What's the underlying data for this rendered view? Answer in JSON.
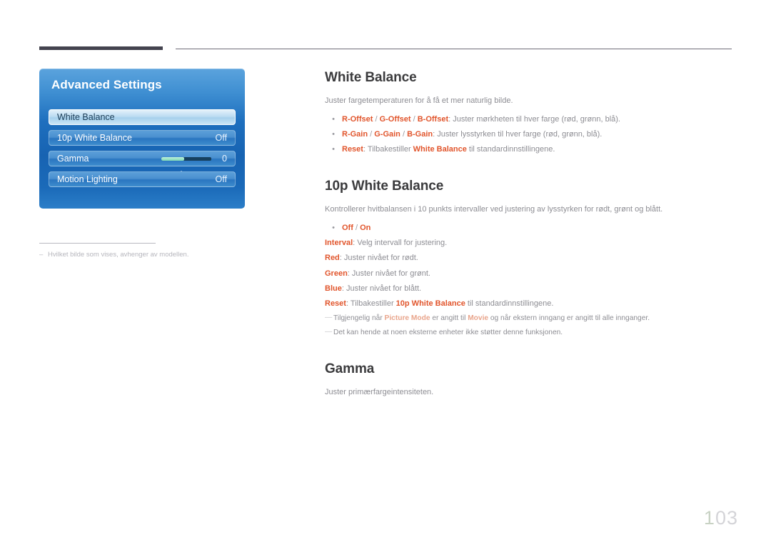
{
  "page": {
    "number": "103",
    "number_first": "1",
    "number_rest": "03"
  },
  "osd": {
    "title": "Advanced Settings",
    "up_arrow_icon": "triangle-up-icon",
    "rows": [
      {
        "label": "White Balance",
        "value": "",
        "selected": true,
        "type": "item"
      },
      {
        "label": "10p White Balance",
        "value": "Off",
        "selected": false,
        "type": "item"
      },
      {
        "label": "Gamma",
        "value": "0",
        "selected": false,
        "type": "slider",
        "fill_percent": 46
      },
      {
        "label": "Motion Lighting",
        "value": "Off",
        "selected": false,
        "type": "item"
      }
    ]
  },
  "left_note": {
    "dash": "–",
    "text": "Hvilket bilde som vises, avhenger av modellen."
  },
  "sections": [
    {
      "heading": "White Balance",
      "intro": "Juster fargetemperaturen for å få et mer naturlig bilde.",
      "lines": [
        {
          "bullet": "•",
          "parts": [
            {
              "t": "R-Offset",
              "s": "em"
            },
            {
              "t": " / ",
              "s": "sep"
            },
            {
              "t": "G-Offset",
              "s": "em"
            },
            {
              "t": " / ",
              "s": "sep"
            },
            {
              "t": "B-Offset",
              "s": "em"
            },
            {
              "t": ": Juster mørkheten til hver farge (rød, grønn, blå).",
              "s": "plain"
            }
          ]
        },
        {
          "bullet": "•",
          "parts": [
            {
              "t": "R-Gain",
              "s": "em"
            },
            {
              "t": " / ",
              "s": "sep"
            },
            {
              "t": "G-Gain",
              "s": "em"
            },
            {
              "t": " / ",
              "s": "sep"
            },
            {
              "t": "B-Gain",
              "s": "em"
            },
            {
              "t": ": Juster lysstyrken til hver farge (rød, grønn, blå).",
              "s": "plain"
            }
          ]
        },
        {
          "bullet": "•",
          "parts": [
            {
              "t": "Reset",
              "s": "em"
            },
            {
              "t": ": Tilbakestiller ",
              "s": "plain"
            },
            {
              "t": "White Balance",
              "s": "em"
            },
            {
              "t": " til standardinnstillingene.",
              "s": "plain"
            }
          ]
        }
      ],
      "footnotes": []
    },
    {
      "heading": "10p White Balance",
      "intro": "Kontrollerer hvitbalansen i 10 punkts intervaller ved justering av lysstyrken for rødt, grønt og blått.",
      "lines": [
        {
          "bullet": "•",
          "parts": [
            {
              "t": "Off",
              "s": "em"
            },
            {
              "t": " / ",
              "s": "sep"
            },
            {
              "t": "On",
              "s": "em"
            }
          ]
        },
        {
          "bullet": "",
          "parts": [
            {
              "t": "Interval",
              "s": "em"
            },
            {
              "t": ": Velg intervall for justering.",
              "s": "plain"
            }
          ]
        },
        {
          "bullet": "",
          "parts": [
            {
              "t": "Red",
              "s": "em"
            },
            {
              "t": ": Juster nivået for rødt.",
              "s": "plain"
            }
          ]
        },
        {
          "bullet": "",
          "parts": [
            {
              "t": "Green",
              "s": "em"
            },
            {
              "t": ": Juster nivået for grønt.",
              "s": "plain"
            }
          ]
        },
        {
          "bullet": "",
          "parts": [
            {
              "t": "Blue",
              "s": "em"
            },
            {
              "t": ": Juster nivået for blått.",
              "s": "plain"
            }
          ]
        },
        {
          "bullet": "",
          "parts": [
            {
              "t": "Reset",
              "s": "em"
            },
            {
              "t": ": Tilbakestiller ",
              "s": "plain"
            },
            {
              "t": "10p White Balance",
              "s": "em"
            },
            {
              "t": " til standardinnstillingene.",
              "s": "plain"
            }
          ]
        }
      ],
      "footnotes": [
        {
          "dash": "―",
          "parts": [
            {
              "t": "Tilgjengelig når ",
              "s": "plain"
            },
            {
              "t": "Picture Mode",
              "s": "em"
            },
            {
              "t": " er angitt til ",
              "s": "plain"
            },
            {
              "t": "Movie",
              "s": "em"
            },
            {
              "t": " og når ekstern inngang er angitt til alle innganger.",
              "s": "plain"
            }
          ]
        },
        {
          "dash": "―",
          "parts": [
            {
              "t": "Det kan hende at noen eksterne enheter ikke støtter denne funksjonen.",
              "s": "plain"
            }
          ]
        }
      ]
    },
    {
      "heading": "Gamma",
      "intro": "Juster primærfargeintensiteten.",
      "lines": [],
      "footnotes": []
    }
  ],
  "colors": {
    "accent_orange": "#e1552c",
    "heading_gray": "#3b3b3d",
    "body_gray": "#8d8d93",
    "footnote_gray": "#c0c0c6",
    "rule_dark": "#44434f",
    "osd_blue": "#1763b2",
    "slider_fill": "#7fd9b4"
  }
}
